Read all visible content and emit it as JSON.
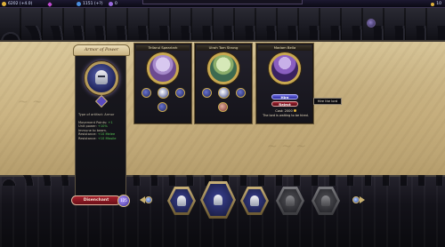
{
  "topbar": {
    "gold": "6202 (+4.0)",
    "gems": "",
    "mana": "1151 (+?)",
    "crowns": "0",
    "right": "10"
  },
  "artifact": {
    "banner": "Armor of Power",
    "type_line": "Type of artifact: Armor",
    "stats": [
      {
        "label": "Movement Points:",
        "value": "+1"
      },
      {
        "label": "Unit power:",
        "value": "+10%"
      },
      {
        "label": "Immune to beam.",
        "value": ""
      },
      {
        "label": "Resistance:",
        "value": "+10 Melee"
      },
      {
        "label": "Resistance:",
        "value": "+10 Missile"
      }
    ],
    "discard_label": "Disenchant",
    "discard_value": "125"
  },
  "lords": [
    {
      "name": "Tellarul Spearlark",
      "portrait": "elf-mage"
    },
    {
      "name": "Ulrah Tom Strong",
      "portrait": "green-druid"
    },
    {
      "name": "Madam Bella",
      "portrait": "witch",
      "hire_label": "Hire",
      "reject_label": "Reject",
      "cost_label": "Cost: 2000",
      "waiting_text": "The lord is waiting to be hired."
    }
  ],
  "tooltip": "Hire the lord",
  "icons": {
    "helm": "helm-icon",
    "gold": "gold-coin-icon",
    "left_arrow": "scroll-left-icon",
    "right_arrow": "scroll-right-icon"
  }
}
